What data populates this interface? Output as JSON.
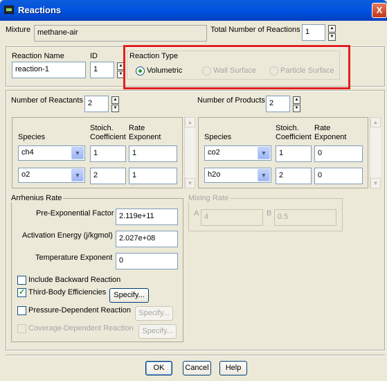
{
  "window": {
    "title": "Reactions",
    "close_glyph": "X"
  },
  "mixture": {
    "label": "Mixture",
    "value": "methane-air"
  },
  "total": {
    "label": "Total Number of Reactions",
    "value": "1"
  },
  "reaction": {
    "name_label": "Reaction Name",
    "name_value": "reaction-1",
    "id_label": "ID",
    "id_value": "1"
  },
  "reaction_type": {
    "label": "Reaction Type",
    "options": [
      "Volumetric",
      "Wall Surface",
      "Particle Surface"
    ],
    "selected": "Volumetric"
  },
  "reactants": {
    "count_label": "Number of Reactants",
    "count": "2",
    "col_species": "Species",
    "col_coef_1": "Stoich.",
    "col_coef_2": "Coefficient",
    "col_exp_1": "Rate",
    "col_exp_2": "Exponent",
    "rows": [
      {
        "species": "ch4",
        "coef": "1",
        "exp": "1"
      },
      {
        "species": "o2",
        "coef": "2",
        "exp": "1"
      }
    ]
  },
  "products": {
    "count_label": "Number of Products",
    "count": "2",
    "col_species": "Species",
    "col_coef_1": "Stoich.",
    "col_coef_2": "Coefficient",
    "col_exp_1": "Rate",
    "col_exp_2": "Exponent",
    "rows": [
      {
        "species": "co2",
        "coef": "1",
        "exp": "0"
      },
      {
        "species": "h2o",
        "coef": "2",
        "exp": "0"
      }
    ]
  },
  "arrhenius": {
    "label": "Arrhenius Rate",
    "pre_exp_label": "Pre-Exponential Factor",
    "pre_exp_value": "2.119e+11",
    "act_label": "Activation Energy (j/kgmol)",
    "act_value": "2.027e+08",
    "temp_label": "Temperature Exponent",
    "temp_value": "0"
  },
  "options": {
    "backward": {
      "label": "Include Backward Reaction",
      "checked": false
    },
    "third_body": {
      "label": "Third-Body Efficiencies",
      "checked": true,
      "button": "Specify..."
    },
    "pressure": {
      "label": "Pressure-Dependent Reaction",
      "checked": false,
      "button": "Specify..."
    },
    "coverage": {
      "label": "Coverage-Dependent Reaction",
      "checked": false,
      "button": "Specify..."
    }
  },
  "mixing": {
    "label": "Mixing Rate",
    "a_label": "A",
    "a_value": "4",
    "b_label": "B",
    "b_value": "0.5"
  },
  "buttons": {
    "ok": "OK",
    "cancel": "Cancel",
    "help": "Help"
  },
  "glyphs": {
    "up": "▲",
    "down": "▼",
    "check": "✓"
  },
  "colors": {
    "highlight_box": "#e02020",
    "title_bar": "#0054e3"
  }
}
